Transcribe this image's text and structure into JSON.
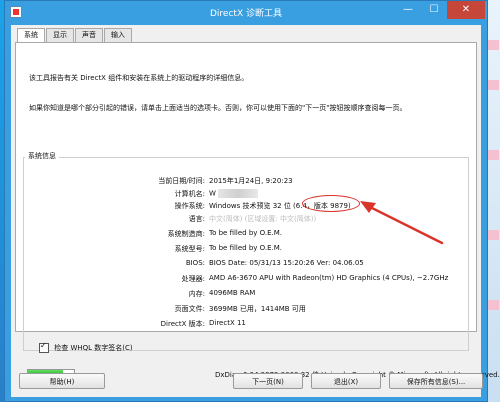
{
  "window": {
    "title": "DirectX 诊断工具",
    "min_glyph": "—",
    "max_glyph": "☐",
    "close_glyph": "✕"
  },
  "tabs": [
    {
      "label": "系统",
      "active": true
    },
    {
      "label": "显示",
      "active": false
    },
    {
      "label": "声音",
      "active": false
    },
    {
      "label": "输入",
      "active": false
    }
  ],
  "intro": {
    "line1": "该工具报告有关 DirectX 组件和安装在系统上的驱动程序的详细信息。",
    "line2": "如果你知道是哪个部分引起的错误，请单击上面适当的选项卡。否则，你可以使用下面的\"下一页\"按钮按顺序查阅每一页。"
  },
  "system_info": {
    "group_label": "系统信息",
    "rows": [
      {
        "key": "当前日期/时间:",
        "value": "2015年1月24日, 9:20:23"
      },
      {
        "key": "计算机名:",
        "value": "W"
      },
      {
        "key": "操作系统:",
        "value": "Windows 技术预览 32 位 (6.4，版本 9879)"
      },
      {
        "key": "语言:",
        "value": "中文(简体) (区域设置: 中文(简体))"
      },
      {
        "key": "系统制造商:",
        "value": "To be filled by O.E.M."
      },
      {
        "key": "系统型号:",
        "value": "To be filled by O.E.M."
      },
      {
        "key": "BIOS:",
        "value": "BIOS Date: 05/31/13 15:20:26 Ver: 04.06.05"
      },
      {
        "key": "处理器:",
        "value": "AMD A6-3670 APU with Radeon(tm) HD Graphics (4 CPUs), ~2.7GHz"
      },
      {
        "key": "内存:",
        "value": "4096MB RAM"
      },
      {
        "key": "页面文件:",
        "value": "3699MB 已用，1414MB 可用"
      },
      {
        "key": "DirectX 版本:",
        "value": "DirectX 11"
      }
    ]
  },
  "whql_checkbox": {
    "label": "检查 WHQL 数字签名(C)",
    "checked": true
  },
  "progress": {
    "fraction": 0.75
  },
  "footer_text": "DxDiag 6.04.9879.0000 32 位 Unicode  Copyright © Microsoft. All rights reserved.",
  "buttons": {
    "help": "帮助(H)",
    "next": "下一页(N)",
    "exit": "退出(X)",
    "save": "保存所有信息(S)..."
  },
  "colors": {
    "accent": "#3a9fe0",
    "annotation_red": "#d9342b",
    "progress_green": "#19b319"
  }
}
